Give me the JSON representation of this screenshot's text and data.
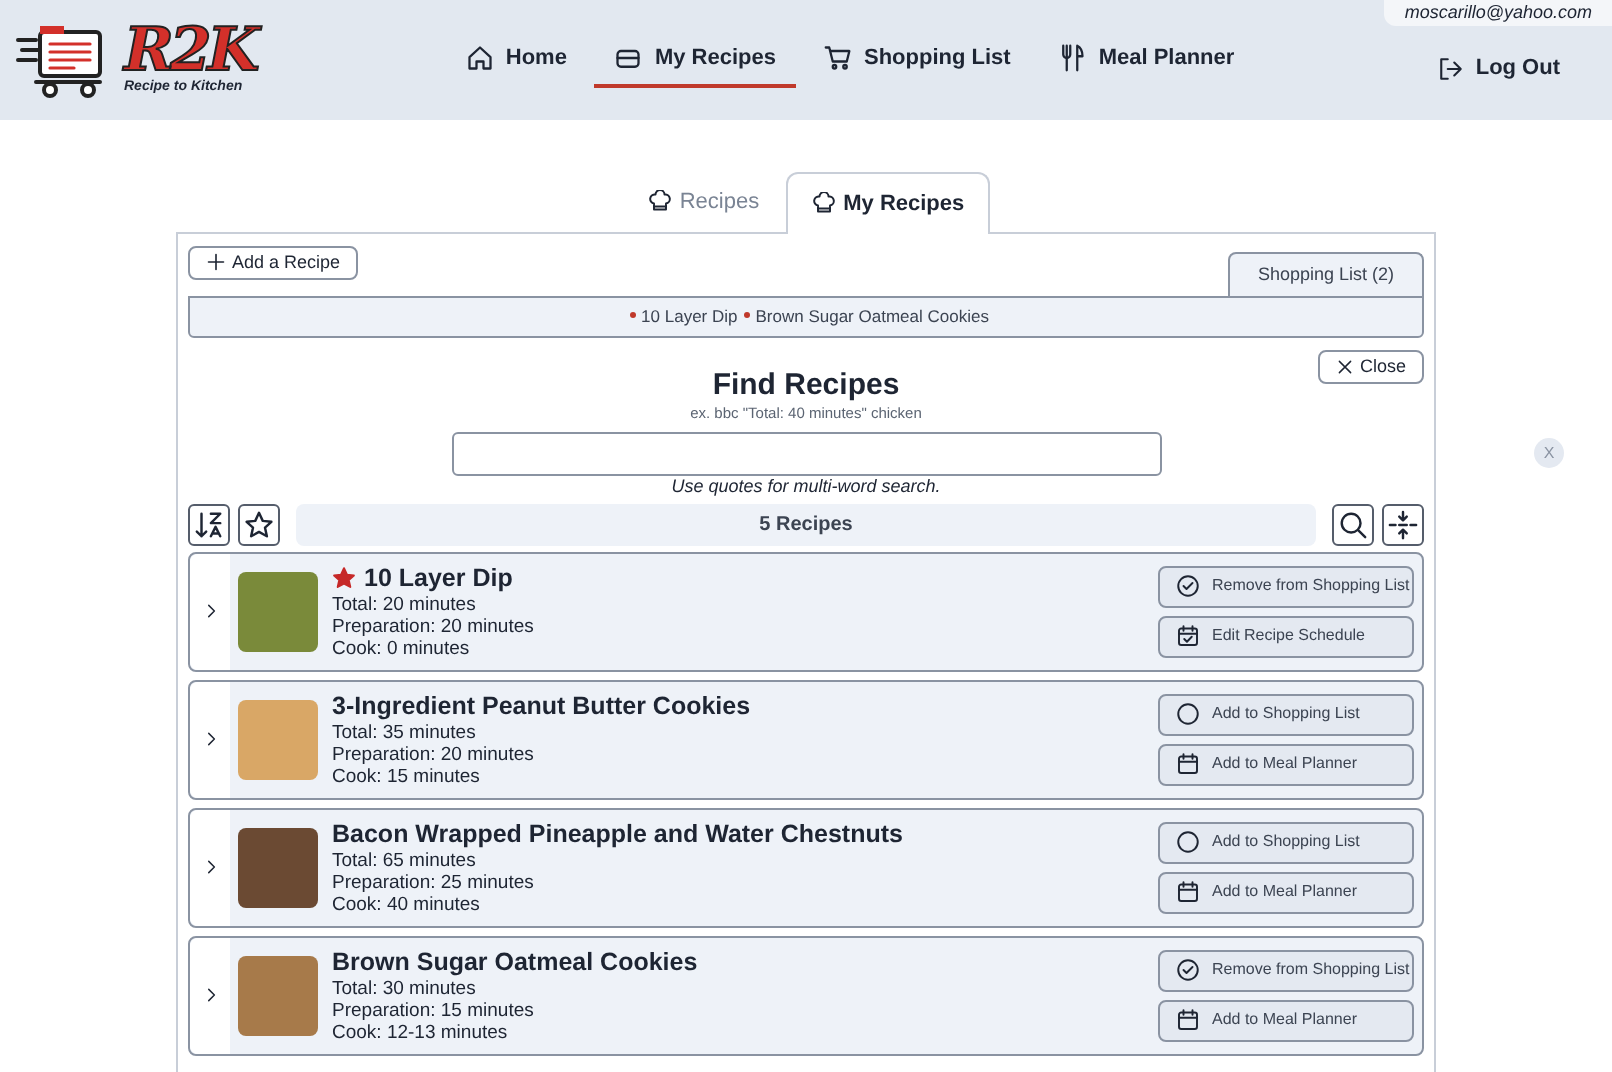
{
  "header": {
    "logo_mark": "R2K",
    "logo_tagline": "Recipe to Kitchen",
    "user_email": "moscarillo@yahoo.com",
    "nav": [
      {
        "label": "Home",
        "selected": false
      },
      {
        "label": "My Recipes",
        "selected": true
      },
      {
        "label": "Shopping List",
        "selected": false
      },
      {
        "label": "Meal Planner",
        "selected": false
      }
    ],
    "logout": "Log Out"
  },
  "tabs": [
    {
      "label": "Recipes",
      "selected": false
    },
    {
      "label": "My Recipes",
      "selected": true
    }
  ],
  "add_button": "Add a Recipe",
  "shopping_tab": "Shopping List (2)",
  "shopping_items": [
    "10 Layer Dip",
    "Brown Sugar Oatmeal Cookies"
  ],
  "close_button": "Close",
  "find": {
    "title": "Find Recipes",
    "example": "ex. bbc \"Total: 40 minutes\" chicken",
    "note": "Use quotes for multi-word search."
  },
  "count": "5 Recipes",
  "side_close": "X",
  "recipes": [
    {
      "name": "10 Layer Dip",
      "favorite": true,
      "total": "Total: 20 minutes",
      "prep": "Preparation: 20 minutes",
      "cook": "Cook: 0 minutes",
      "in_list": true,
      "list_action": "Remove from Shopping List",
      "scheduled": true,
      "plan_action": "Edit Recipe Schedule"
    },
    {
      "name": "3-Ingredient Peanut Butter Cookies",
      "favorite": false,
      "total": "Total: 35 minutes",
      "prep": "Preparation: 20 minutes",
      "cook": "Cook: 15 minutes",
      "in_list": false,
      "list_action": "Add to Shopping List",
      "scheduled": false,
      "plan_action": "Add to Meal Planner"
    },
    {
      "name": "Bacon Wrapped Pineapple and Water Chestnuts",
      "favorite": false,
      "total": "Total: 65 minutes",
      "prep": "Preparation: 25 minutes",
      "cook": "Cook: 40 minutes",
      "in_list": false,
      "list_action": "Add to Shopping List",
      "scheduled": false,
      "plan_action": "Add to Meal Planner"
    },
    {
      "name": "Brown Sugar Oatmeal Cookies",
      "favorite": false,
      "total": "Total: 30 minutes",
      "prep": "Preparation: 15 minutes",
      "cook": "Cook: 12-13 minutes",
      "in_list": true,
      "list_action": "Remove from Shopping List",
      "scheduled": false,
      "plan_action": "Add to Meal Planner"
    }
  ]
}
